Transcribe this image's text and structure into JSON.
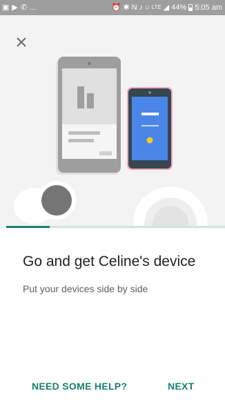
{
  "status_bar": {
    "left_ellipsis": "...",
    "battery": "44%",
    "time": "5:05 am",
    "icons": [
      "image-icon",
      "play-store-icon",
      "whatsapp-icon",
      "alarm-icon",
      "bluetooth-icon",
      "nfc-icon",
      "mute-icon",
      "wifi-icon",
      "lte-icon",
      "signal-icon",
      "battery-icon"
    ]
  },
  "illustration": {
    "background": "#f3f3f3",
    "tablet_color": "#9e9e9e",
    "phone_screen_color": "#4a86e8",
    "phone_dot_color": "#fbcb1b",
    "phone_border_color": "#f0a8bd"
  },
  "progress": {
    "fraction": 0.2,
    "fill_color": "#1a7f6e",
    "track_color": "#cfe3df"
  },
  "main": {
    "title": "Go and get Celine's device",
    "subtitle": "Put your devices side by side"
  },
  "actions": {
    "help_label": "NEED SOME HELP?",
    "next_label": "NEXT",
    "accent_color": "#1a7f6e"
  }
}
